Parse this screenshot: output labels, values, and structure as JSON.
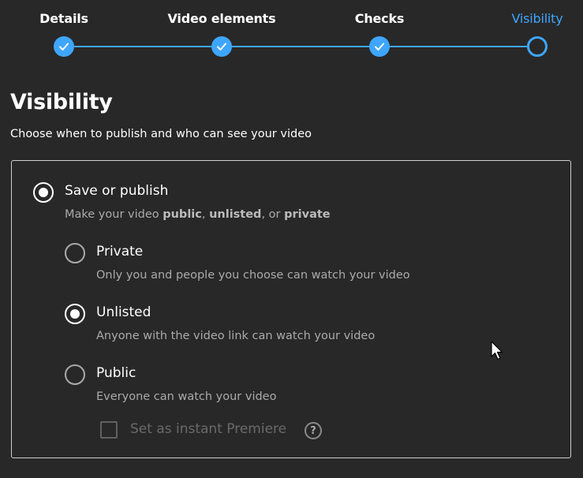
{
  "stepper": {
    "steps": [
      {
        "label": "Details",
        "state": "done"
      },
      {
        "label": "Video elements",
        "state": "done"
      },
      {
        "label": "Checks",
        "state": "done"
      },
      {
        "label": "Visibility",
        "state": "current"
      }
    ]
  },
  "page": {
    "title": "Visibility",
    "subtitle": "Choose when to publish and who can see your video"
  },
  "save_publish": {
    "label": "Save or publish",
    "desc_prefix": "Make your video ",
    "desc_public": "public",
    "desc_sep1": ", ",
    "desc_unlisted": "unlisted",
    "desc_sep2": ", or ",
    "desc_private": "private",
    "selected": true
  },
  "options": [
    {
      "label": "Private",
      "description": "Only you and people you choose can watch your video",
      "selected": false
    },
    {
      "label": "Unlisted",
      "description": "Anyone with the video link can watch your video",
      "selected": true
    },
    {
      "label": "Public",
      "description": "Everyone can watch your video",
      "selected": false
    }
  ],
  "premiere": {
    "label": "Set as instant Premiere",
    "checked": false,
    "disabled": true,
    "help_glyph": "?"
  },
  "colors": {
    "accent": "#3ea6ff",
    "background": "#282828",
    "text": "#ffffff",
    "secondary_text": "#aaaaaa"
  }
}
